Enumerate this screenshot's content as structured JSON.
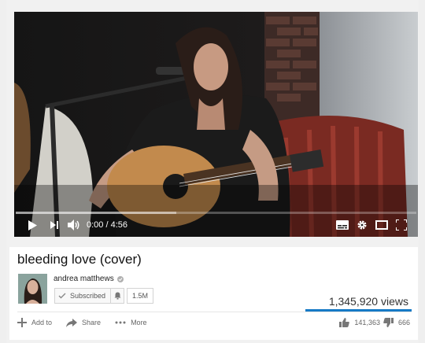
{
  "player": {
    "time_display": "0:00 / 4:56",
    "progress": 0,
    "buffered_fraction": 0.4
  },
  "video": {
    "title": "bleeding love (cover)",
    "views": "1,345,920 views",
    "likes": "141,363",
    "dislikes": "666"
  },
  "channel": {
    "name": "andrea matthews",
    "subscribed_label": "Subscribed",
    "subscriber_count": "1.5M"
  },
  "actions": {
    "add_to": "Add to",
    "share": "Share",
    "more": "More"
  },
  "colors": {
    "accent": "#167ac6",
    "player_bg": "#141414"
  }
}
